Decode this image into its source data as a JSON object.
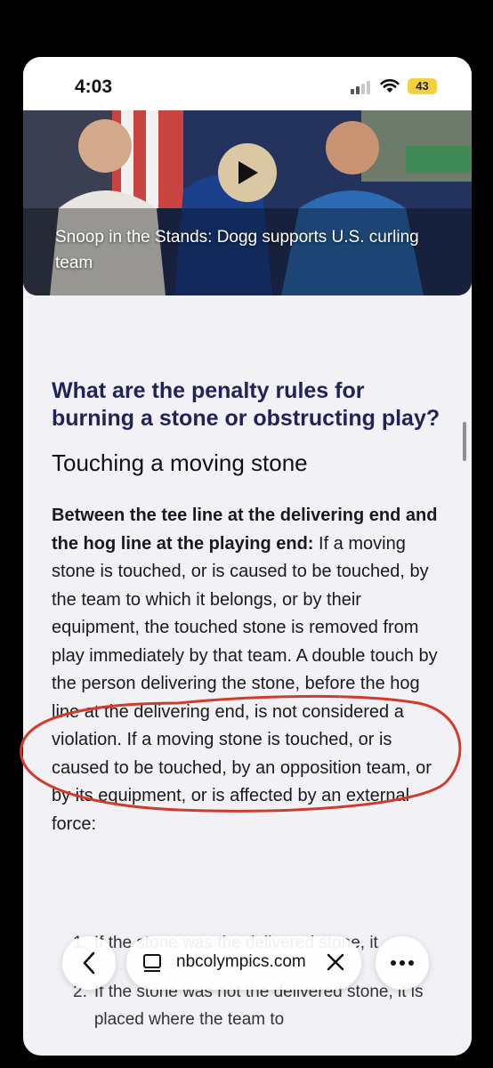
{
  "status_bar": {
    "time": "4:03",
    "battery": "43"
  },
  "video": {
    "caption": "Snoop in the Stands: Dogg supports U.S. curling team",
    "icon": "play-icon"
  },
  "article": {
    "question_heading": "What are the penalty rules for burning a stone or obstructing play?",
    "section_heading": "Touching a moving stone",
    "paragraph_bold": "Between the tee line at the delivering end and the hog line at the playing end:",
    "paragraph_text": " If a moving stone is touched, or is caused to be touched, by the team to which it belongs, or by their equipment, the touched stone is removed from play immediately by that team. A double touch by the person delivering the stone, before the hog line at the delivering end, is not considered a violation. If a moving stone is touched, or is caused to be touched, by an opposition team, or by its equipment, or is affected by an external force:",
    "list": [
      {
        "num": "1.",
        "text": "If the stone was the delivered stone, it"
      },
      {
        "num": "2.",
        "text": "If the stone was not the delivered stone, it is placed where the team to"
      }
    ]
  },
  "toolbar": {
    "url": "nbcolympics.com",
    "back_icon": "chevron-left-icon",
    "tabs_icon": "tabs-icon",
    "close_icon": "close-icon",
    "more_icon": "more-icon"
  },
  "colors": {
    "heading": "#1f2358",
    "annotation": "#d23a2a",
    "battery": "#f4d03f"
  }
}
